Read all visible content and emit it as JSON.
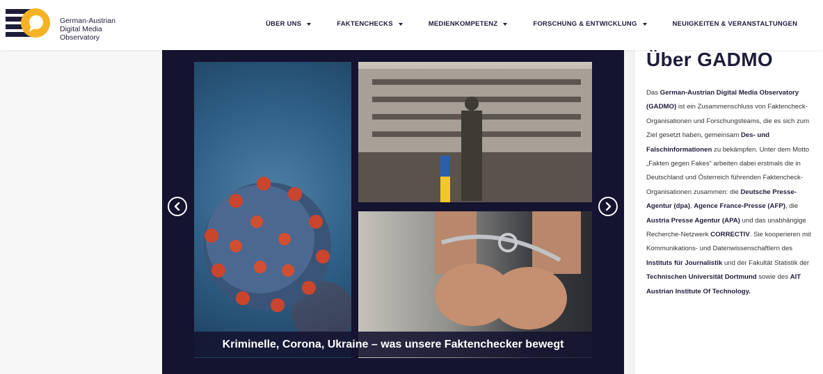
{
  "logo": {
    "line1": "German-Austrian",
    "line2": "Digital Media",
    "line3": "Observatory",
    "colors": {
      "stripes": "#1d1d3a",
      "circle": "#f5b324"
    }
  },
  "nav": [
    {
      "label": "ÜBER UNS",
      "has_dropdown": true
    },
    {
      "label": "FAKTENCHECKS",
      "has_dropdown": true
    },
    {
      "label": "MEDIENKOMPETENZ",
      "has_dropdown": true
    },
    {
      "label": "FORSCHUNG & ENTWICKLUNG",
      "has_dropdown": true
    },
    {
      "label": "NEUIGKEITEN & VERANSTALTUNGEN",
      "has_dropdown": false
    }
  ],
  "slider": {
    "caption": "Kriminelle, Corona, Ukraine – was unsere Faktenchecker bewegt",
    "prev_icon": "chevron-left-circle-icon",
    "next_icon": "chevron-right-circle-icon",
    "background": "#141330"
  },
  "sidebar": {
    "title": "Über GADMO",
    "paragraph": [
      {
        "t": "Das "
      },
      {
        "t": "German-Austrian Digital Media Observatory (GADMO)",
        "b": true
      },
      {
        "t": " ist ein Zusammenschluss von Faktencheck-Organisationen und Forschungsteams, die es sich zum Ziel gesetzt haben, gemeinsam "
      },
      {
        "t": "Des- und Falschinformationen",
        "b": true
      },
      {
        "t": " zu bekämpfen. Unter dem Motto „Fakten gegen Fakes“ arbeiten dabei erstmals die in Deutschland und Österreich führenden Faktencheck-Organisationen zusammen: die "
      },
      {
        "t": "Deutsche Presse-Agentur (dpa)",
        "b": true
      },
      {
        "t": ", "
      },
      {
        "t": "Agence France-Presse (AFP)",
        "b": true
      },
      {
        "t": ", die "
      },
      {
        "t": "Austria Presse Agentur (APA)",
        "b": true
      },
      {
        "t": " und das unabhängige Recherche-Netzwerk "
      },
      {
        "t": "CORRECTIV",
        "b": true
      },
      {
        "t": ". Sie kooperieren mit Kommunikations- und Datenwissenschaftlern des "
      },
      {
        "t": "Instituts für Journalistik",
        "b": true
      },
      {
        "t": " und der Fakultät Statistik der "
      },
      {
        "t": "Technischen Universität Dortmund",
        "b": true
      },
      {
        "t": " sowie des "
      },
      {
        "t": "AIT Austrian Institute Of Technology.",
        "b": true
      }
    ]
  }
}
